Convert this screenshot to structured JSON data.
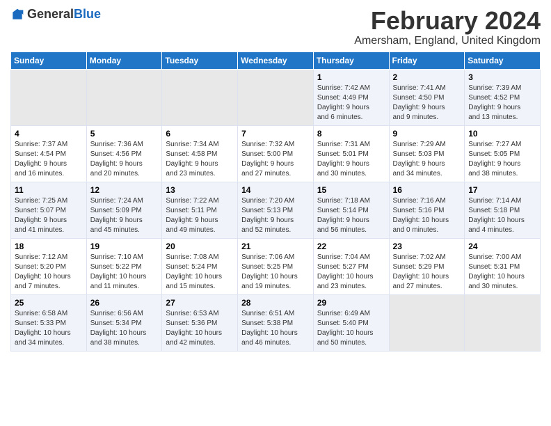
{
  "header": {
    "logo_general": "General",
    "logo_blue": "Blue",
    "title": "February 2024",
    "subtitle": "Amersham, England, United Kingdom"
  },
  "days_of_week": [
    "Sunday",
    "Monday",
    "Tuesday",
    "Wednesday",
    "Thursday",
    "Friday",
    "Saturday"
  ],
  "weeks": [
    [
      {
        "day": "",
        "info": ""
      },
      {
        "day": "",
        "info": ""
      },
      {
        "day": "",
        "info": ""
      },
      {
        "day": "",
        "info": ""
      },
      {
        "day": "1",
        "info": "Sunrise: 7:42 AM\nSunset: 4:49 PM\nDaylight: 9 hours\nand 6 minutes."
      },
      {
        "day": "2",
        "info": "Sunrise: 7:41 AM\nSunset: 4:50 PM\nDaylight: 9 hours\nand 9 minutes."
      },
      {
        "day": "3",
        "info": "Sunrise: 7:39 AM\nSunset: 4:52 PM\nDaylight: 9 hours\nand 13 minutes."
      }
    ],
    [
      {
        "day": "4",
        "info": "Sunrise: 7:37 AM\nSunset: 4:54 PM\nDaylight: 9 hours\nand 16 minutes."
      },
      {
        "day": "5",
        "info": "Sunrise: 7:36 AM\nSunset: 4:56 PM\nDaylight: 9 hours\nand 20 minutes."
      },
      {
        "day": "6",
        "info": "Sunrise: 7:34 AM\nSunset: 4:58 PM\nDaylight: 9 hours\nand 23 minutes."
      },
      {
        "day": "7",
        "info": "Sunrise: 7:32 AM\nSunset: 5:00 PM\nDaylight: 9 hours\nand 27 minutes."
      },
      {
        "day": "8",
        "info": "Sunrise: 7:31 AM\nSunset: 5:01 PM\nDaylight: 9 hours\nand 30 minutes."
      },
      {
        "day": "9",
        "info": "Sunrise: 7:29 AM\nSunset: 5:03 PM\nDaylight: 9 hours\nand 34 minutes."
      },
      {
        "day": "10",
        "info": "Sunrise: 7:27 AM\nSunset: 5:05 PM\nDaylight: 9 hours\nand 38 minutes."
      }
    ],
    [
      {
        "day": "11",
        "info": "Sunrise: 7:25 AM\nSunset: 5:07 PM\nDaylight: 9 hours\nand 41 minutes."
      },
      {
        "day": "12",
        "info": "Sunrise: 7:24 AM\nSunset: 5:09 PM\nDaylight: 9 hours\nand 45 minutes."
      },
      {
        "day": "13",
        "info": "Sunrise: 7:22 AM\nSunset: 5:11 PM\nDaylight: 9 hours\nand 49 minutes."
      },
      {
        "day": "14",
        "info": "Sunrise: 7:20 AM\nSunset: 5:13 PM\nDaylight: 9 hours\nand 52 minutes."
      },
      {
        "day": "15",
        "info": "Sunrise: 7:18 AM\nSunset: 5:14 PM\nDaylight: 9 hours\nand 56 minutes."
      },
      {
        "day": "16",
        "info": "Sunrise: 7:16 AM\nSunset: 5:16 PM\nDaylight: 10 hours\nand 0 minutes."
      },
      {
        "day": "17",
        "info": "Sunrise: 7:14 AM\nSunset: 5:18 PM\nDaylight: 10 hours\nand 4 minutes."
      }
    ],
    [
      {
        "day": "18",
        "info": "Sunrise: 7:12 AM\nSunset: 5:20 PM\nDaylight: 10 hours\nand 7 minutes."
      },
      {
        "day": "19",
        "info": "Sunrise: 7:10 AM\nSunset: 5:22 PM\nDaylight: 10 hours\nand 11 minutes."
      },
      {
        "day": "20",
        "info": "Sunrise: 7:08 AM\nSunset: 5:24 PM\nDaylight: 10 hours\nand 15 minutes."
      },
      {
        "day": "21",
        "info": "Sunrise: 7:06 AM\nSunset: 5:25 PM\nDaylight: 10 hours\nand 19 minutes."
      },
      {
        "day": "22",
        "info": "Sunrise: 7:04 AM\nSunset: 5:27 PM\nDaylight: 10 hours\nand 23 minutes."
      },
      {
        "day": "23",
        "info": "Sunrise: 7:02 AM\nSunset: 5:29 PM\nDaylight: 10 hours\nand 27 minutes."
      },
      {
        "day": "24",
        "info": "Sunrise: 7:00 AM\nSunset: 5:31 PM\nDaylight: 10 hours\nand 30 minutes."
      }
    ],
    [
      {
        "day": "25",
        "info": "Sunrise: 6:58 AM\nSunset: 5:33 PM\nDaylight: 10 hours\nand 34 minutes."
      },
      {
        "day": "26",
        "info": "Sunrise: 6:56 AM\nSunset: 5:34 PM\nDaylight: 10 hours\nand 38 minutes."
      },
      {
        "day": "27",
        "info": "Sunrise: 6:53 AM\nSunset: 5:36 PM\nDaylight: 10 hours\nand 42 minutes."
      },
      {
        "day": "28",
        "info": "Sunrise: 6:51 AM\nSunset: 5:38 PM\nDaylight: 10 hours\nand 46 minutes."
      },
      {
        "day": "29",
        "info": "Sunrise: 6:49 AM\nSunset: 5:40 PM\nDaylight: 10 hours\nand 50 minutes."
      },
      {
        "day": "",
        "info": ""
      },
      {
        "day": "",
        "info": ""
      }
    ]
  ]
}
